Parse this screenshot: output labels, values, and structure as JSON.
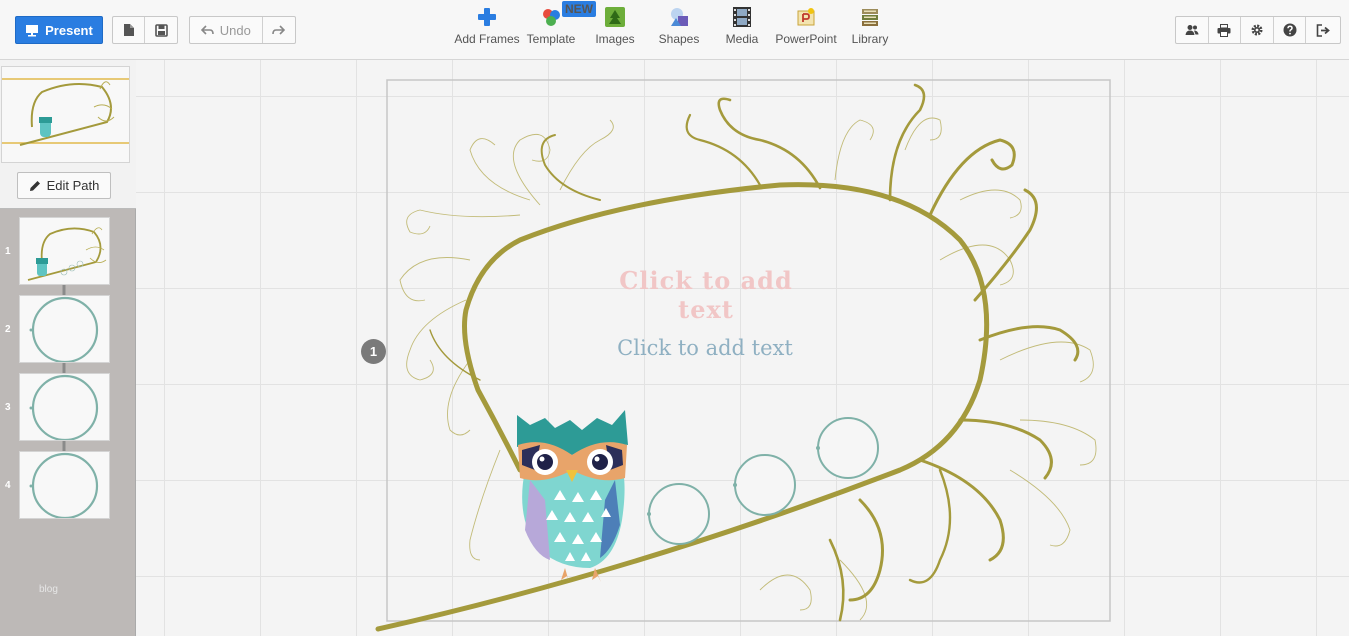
{
  "toolbar": {
    "present_label": "Present",
    "undo_label": "Undo",
    "tools": [
      {
        "label": "Add Frames",
        "icon": "plus-icon"
      },
      {
        "label": "Template",
        "icon": "template-icon",
        "badge": "NEW"
      },
      {
        "label": "Images",
        "icon": "image-icon"
      },
      {
        "label": "Shapes",
        "icon": "shapes-icon"
      },
      {
        "label": "Media",
        "icon": "film-icon"
      },
      {
        "label": "PowerPoint",
        "icon": "powerpoint-icon"
      },
      {
        "label": "Library",
        "icon": "library-icon"
      }
    ]
  },
  "sidebar": {
    "edit_path_label": "Edit Path",
    "frames": [
      {
        "number": "1"
      },
      {
        "number": "2"
      },
      {
        "number": "3"
      },
      {
        "number": "4"
      }
    ],
    "footer": "blog"
  },
  "canvas": {
    "title_placeholder": "Click to add text",
    "subtitle_placeholder": "Click to add text",
    "step_number": "1"
  },
  "colors": {
    "accent": "#2a7de1",
    "branch": "#a49a3c",
    "frame_circle": "#7fb1a8"
  }
}
